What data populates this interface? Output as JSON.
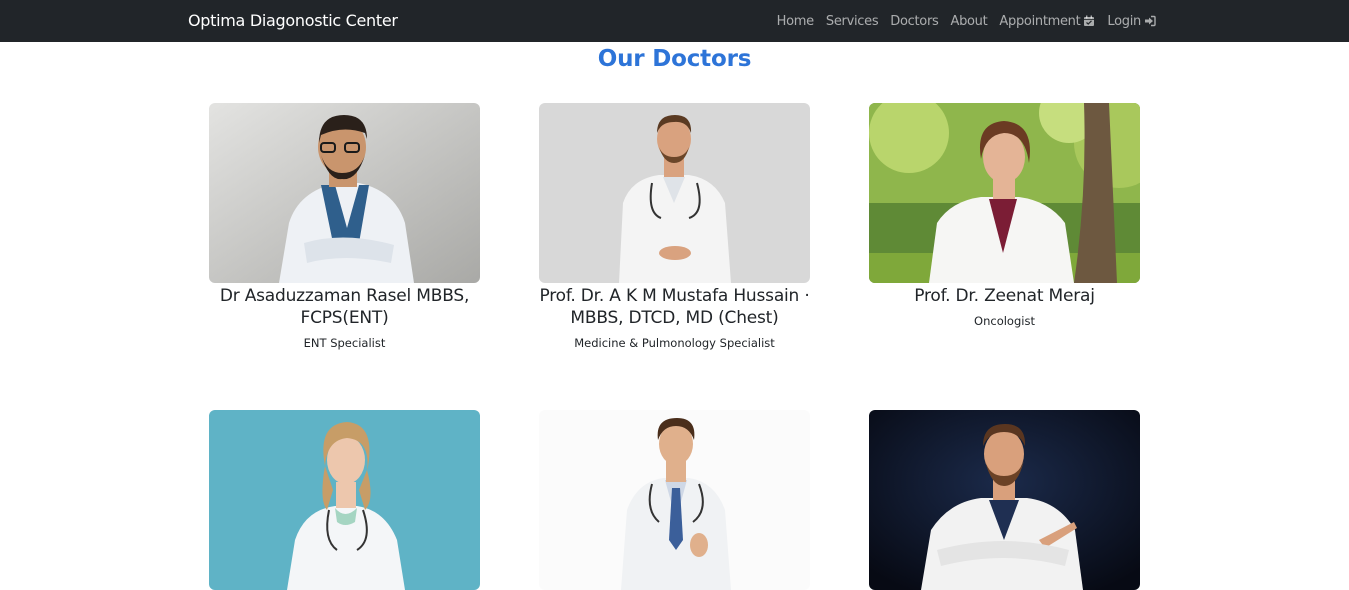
{
  "navbar": {
    "brand": "Optima Diagonostic Center",
    "links": [
      {
        "label": "Home"
      },
      {
        "label": "Services"
      },
      {
        "label": "Doctors"
      },
      {
        "label": "About"
      },
      {
        "label": "Appointment",
        "icon": "calendar-check-icon"
      },
      {
        "label": "Login",
        "icon": "sign-in-icon"
      }
    ],
    "bg_color": "#212529"
  },
  "page": {
    "title": "Our Doctors",
    "title_color": "#2d74d8"
  },
  "doctors": [
    {
      "name": "Dr Asaduzzaman Rasel MBBS, FCPS(ENT)",
      "specialty": "ENT Specialist"
    },
    {
      "name": "Prof. Dr. A K M Mustafa Hussain · MBBS, DTCD, MD (Chest)",
      "specialty": "Medicine & Pulmonology Specialist"
    },
    {
      "name": "Prof. Dr. Zeenat Meraj",
      "specialty": "Oncologist"
    },
    {
      "name": "",
      "specialty": ""
    },
    {
      "name": "",
      "specialty": ""
    },
    {
      "name": "",
      "specialty": ""
    }
  ]
}
